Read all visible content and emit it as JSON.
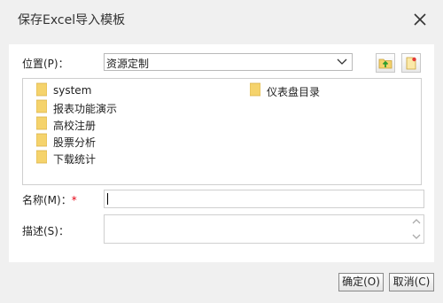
{
  "dialog": {
    "title": "保存Excel导入模板"
  },
  "location": {
    "label": "位置(P)：",
    "value": "资源定制"
  },
  "toolbar": {
    "up_icon": "folder-up-icon",
    "new_icon": "new-folder-icon"
  },
  "folders": [
    {
      "name": "system"
    },
    {
      "name": "仪表盘目录"
    },
    {
      "name": "报表功能演示"
    },
    {
      "name": "高校注册"
    },
    {
      "name": "股票分析"
    },
    {
      "name": "下载统计"
    }
  ],
  "name_field": {
    "label": "名称(M)：",
    "required_mark": "*",
    "value": ""
  },
  "desc_field": {
    "label": "描述(S)：",
    "value": ""
  },
  "buttons": {
    "ok": "确定(O)",
    "cancel": "取消(C)"
  },
  "colors": {
    "panel": "#ffffff",
    "background": "#f0f0f0",
    "folder": "#f5d36c",
    "required": "#e60012"
  }
}
